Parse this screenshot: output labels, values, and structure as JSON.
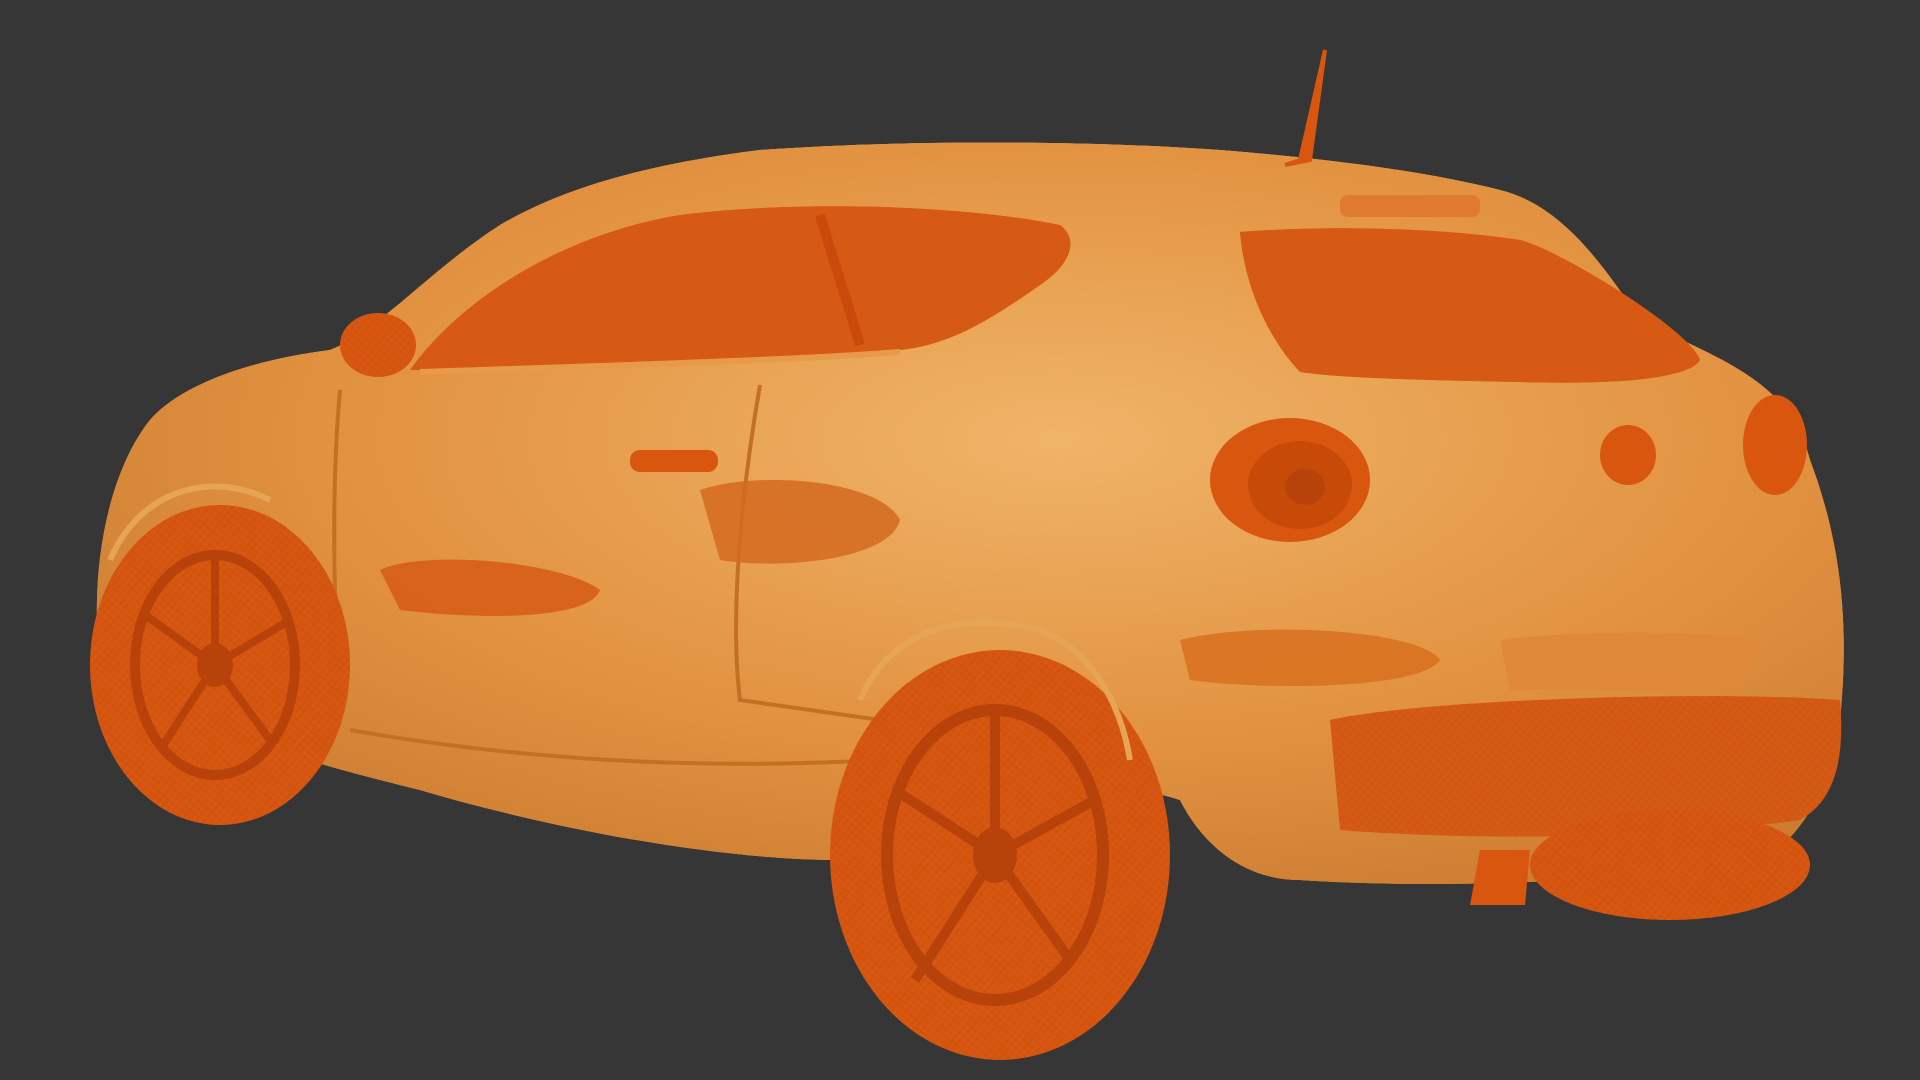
{
  "scene": {
    "subject": "car-wireframe",
    "render_mode": "wireframe-on-shaded",
    "view": "rear-three-quarter",
    "colors": {
      "background": "#363636",
      "body_fill": "#e3903f",
      "body_fill_light": "#ecaa5e",
      "solid_orange": "#d9560f",
      "deep_orange": "#c94a0a",
      "wire": "#f1c989",
      "wire_dark": "#8a5a2a"
    }
  }
}
